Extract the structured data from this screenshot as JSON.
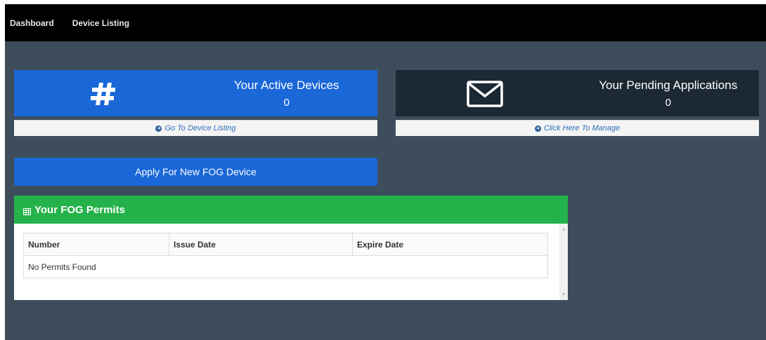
{
  "nav": {
    "items": [
      {
        "label": "Dashboard"
      },
      {
        "label": "Device Listing"
      }
    ]
  },
  "cards": {
    "active_devices": {
      "title": "Your Active Devices",
      "value": "0",
      "footer_link": "Go To Device Listing",
      "icon": "hashtag-icon",
      "color": "#1a67d8"
    },
    "pending_applications": {
      "title": "Your Pending Applications",
      "value": "0",
      "footer_link": "Click Here To Manage",
      "icon": "envelope-icon",
      "color": "#1c2834"
    }
  },
  "apply_button": {
    "label": "Apply For New FOG Device",
    "color": "#1a67d8"
  },
  "permits": {
    "title": "Your FOG Permits",
    "header_color": "#24b24a",
    "columns": [
      "Number",
      "Issue Date",
      "Expire Date"
    ],
    "empty_message": "No Permits Found"
  },
  "colors": {
    "page_background": "#3d4d5b",
    "navbar": "#000000"
  }
}
